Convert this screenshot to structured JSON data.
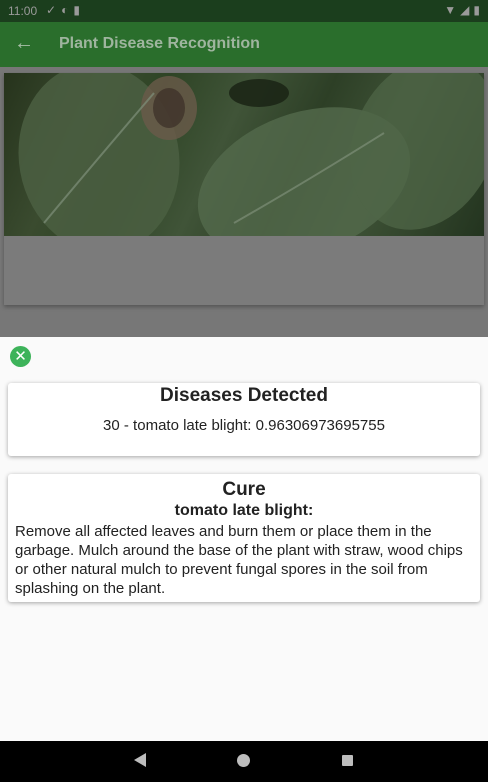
{
  "status_bar": {
    "time": "11:00",
    "left_icons": [
      "check-icon",
      "data-saver-icon",
      "sd-card-icon"
    ],
    "right_icons": [
      "wifi-icon",
      "signal-icon",
      "battery-icon"
    ]
  },
  "app_bar": {
    "title": "Plant Disease Recognition",
    "back_icon": "arrow-back-icon",
    "color": "#2a6e2c"
  },
  "sheet": {
    "close_icon": "close-circle-icon",
    "accent": "#3db35a",
    "diseases_card": {
      "title": "Diseases Detected",
      "result": "30 - tomato late blight: 0.96306973695755"
    },
    "cure_card": {
      "title": "Cure",
      "disease_name": "tomato late blight:",
      "description": "Remove all affected leaves and burn them or place them in the garbage. Mulch around the base of the plant with straw, wood chips or other natural mulch to prevent fungal spores in the soil from splashing on the plant."
    }
  },
  "nav_bar": {
    "icons": [
      "nav-back-icon",
      "nav-home-icon",
      "nav-recents-icon"
    ]
  }
}
